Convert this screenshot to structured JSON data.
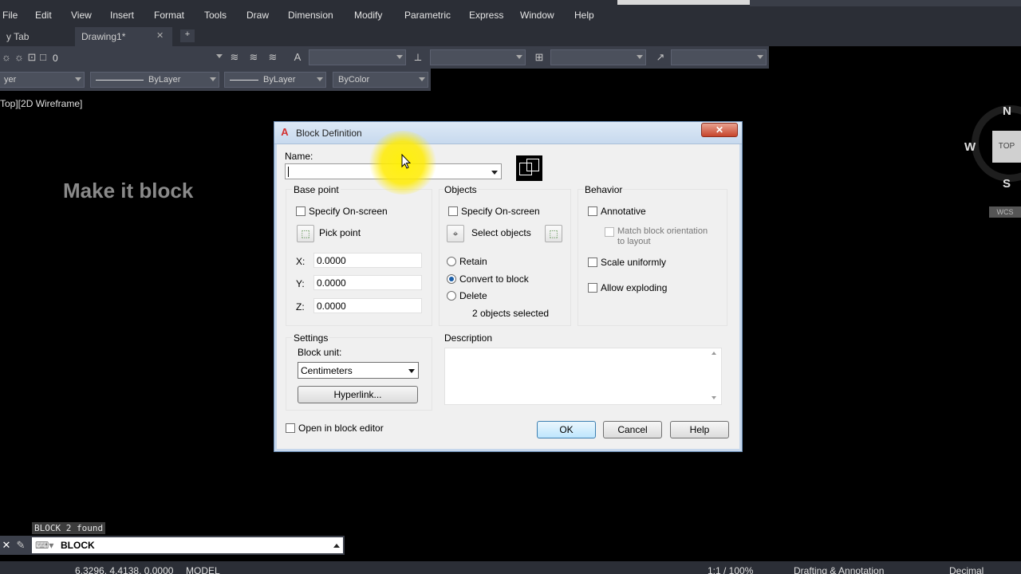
{
  "menu": [
    "File",
    "Edit",
    "View",
    "Insert",
    "Format",
    "Tools",
    "Draw",
    "Dimension",
    "Modify",
    "Parametric",
    "Express",
    "Window",
    "Help"
  ],
  "tabs": {
    "start_tab": "y Tab",
    "drawing_tab": "Drawing1*",
    "close_glyph": "✕",
    "add_glyph": "+"
  },
  "toolbar": {
    "layer_value": "0",
    "linetype": "ByLayer",
    "lineweight": "ByLayer",
    "color": "ByColor",
    "layer_combo": "yer"
  },
  "viewport": {
    "label": "Top][2D Wireframe]"
  },
  "overlay_text": "Make it block",
  "viewcube": {
    "north": "N",
    "west": "W",
    "south": "S",
    "face": "TOP",
    "wcs": "WCS"
  },
  "command": {
    "history": "BLOCK 2 found",
    "input": "BLOCK"
  },
  "status": {
    "coords": "6.3296, 4.4138, 0.0000",
    "space": "MODEL",
    "scale": "1:1 / 100%",
    "workspace": "Drafting & Annotation",
    "units": "Decimal"
  },
  "dialog": {
    "title": "Block Definition",
    "close_glyph": "✕",
    "name_label": "Name:",
    "name_value": "",
    "base_point": {
      "heading": "Base point",
      "specify_on_screen": "Specify On-screen",
      "pick_point": "Pick point",
      "x_label": "X:",
      "x": "0.0000",
      "y_label": "Y:",
      "y": "0.0000",
      "z_label": "Z:",
      "z": "0.0000"
    },
    "objects": {
      "heading": "Objects",
      "specify_on_screen": "Specify On-screen",
      "select_objects": "Select objects",
      "retain": "Retain",
      "convert": "Convert to block",
      "delete": "Delete",
      "selected": "2 objects selected"
    },
    "behavior": {
      "heading": "Behavior",
      "annotative": "Annotative",
      "match_line1": "Match block orientation",
      "match_line2": "to layout",
      "scale_uniformly": "Scale uniformly",
      "allow_exploding": "Allow exploding"
    },
    "settings": {
      "heading": "Settings",
      "block_unit_label": "Block unit:",
      "block_unit": "Centimeters",
      "hyperlink": "Hyperlink..."
    },
    "description_label": "Description",
    "open_in_editor": "Open in block editor",
    "ok": "OK",
    "cancel": "Cancel",
    "help": "Help"
  }
}
